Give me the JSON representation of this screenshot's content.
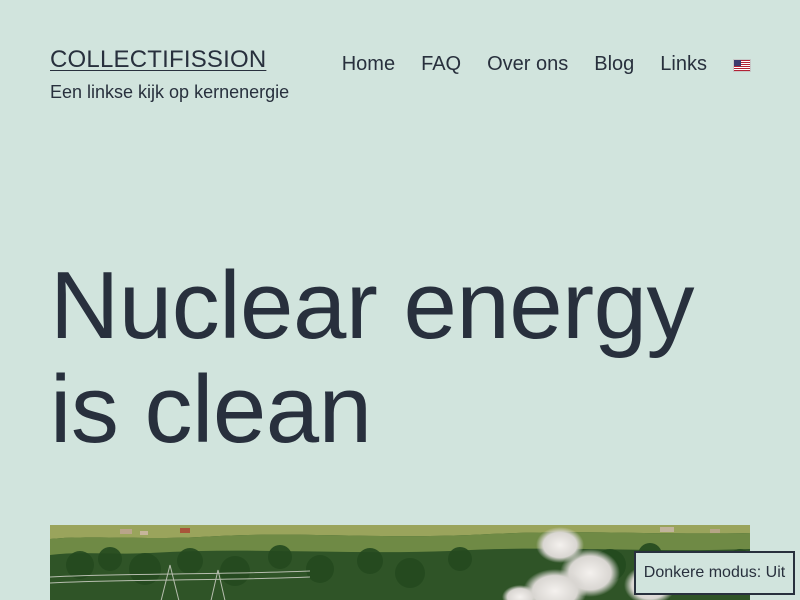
{
  "header": {
    "site_title": "COLLECTIFISSION",
    "tagline": "Een linkse kijk op kernenergie"
  },
  "nav": {
    "items": [
      {
        "label": "Home"
      },
      {
        "label": "FAQ"
      },
      {
        "label": "Over ons"
      },
      {
        "label": "Blog"
      },
      {
        "label": "Links"
      }
    ],
    "language_flag": "us-flag-icon"
  },
  "main": {
    "title": "Nuclear energy is clean"
  },
  "dark_mode_toggle": {
    "label": "Donkere modus: Uit"
  },
  "colors": {
    "background": "#d1e4dd",
    "text": "#28303d"
  }
}
